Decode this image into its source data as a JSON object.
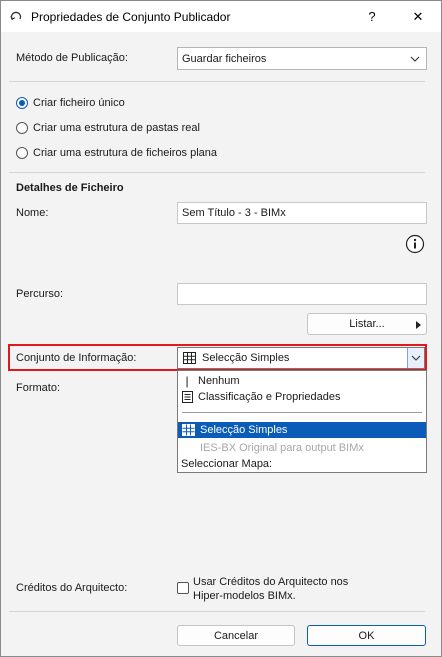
{
  "window": {
    "title": "Propriedades de Conjunto Publicador",
    "help_label": "?",
    "close_label": "✕"
  },
  "publish_method": {
    "label": "Método de Publicação:",
    "value": "Guardar ficheiros"
  },
  "output_options": [
    {
      "label": "Criar ficheiro único",
      "selected": true
    },
    {
      "label": "Criar uma estrutura de pastas real",
      "selected": false
    },
    {
      "label": "Criar uma estrutura de ficheiros plana",
      "selected": false
    }
  ],
  "file_details": {
    "heading": "Detalhes de Ficheiro",
    "name_label": "Nome:",
    "name_value": "Sem Título - 3 - BIMx",
    "info_icon": "info-icon",
    "path_label": "Percurso:",
    "path_value": "",
    "browse_label": "Listar..."
  },
  "info_set": {
    "label": "Conjunto de Informação:",
    "value": "Selecção Simples",
    "highlight_color": "#e0191e"
  },
  "format": {
    "label": "Formato:"
  },
  "dropdown": {
    "items": [
      {
        "label": "Nenhum",
        "icon": "cursor-icon"
      },
      {
        "label": "Classificação e Propriedades",
        "icon": "document-icon"
      },
      {
        "label": "Selecção Simples",
        "icon": "table-icon",
        "selected": true
      },
      {
        "label": "IES-BX Original para output BIMx",
        "disabled": true
      },
      {
        "label": "Seleccionar Mapa:"
      }
    ],
    "selected_color": "#0a5cb8"
  },
  "credits": {
    "label": "Créditos do Arquitecto:",
    "checkbox_label_line1": "Usar Créditos do Arquitecto nos",
    "checkbox_label_line2": "Hiper-modelos BIMx.",
    "checked": false
  },
  "footer": {
    "cancel_label": "Cancelar",
    "ok_label": "OK"
  }
}
